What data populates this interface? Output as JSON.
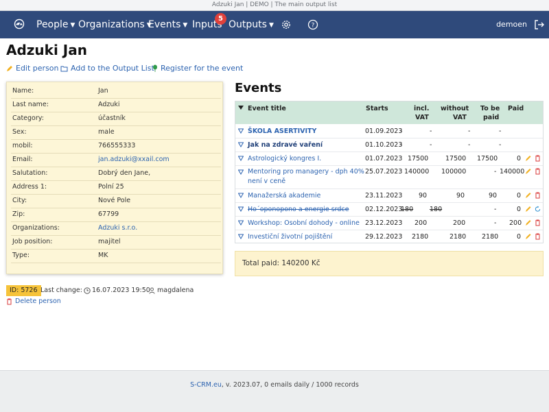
{
  "window": {
    "title": "Adzuki Jan | DEMO | The main output list"
  },
  "nav": {
    "people": "People",
    "organizations": "Organizations",
    "events": "Events",
    "inputs": "Inputs",
    "inputs_badge": "5",
    "outputs": "Outputs",
    "user": "demoen"
  },
  "page": {
    "title": "Adzuki Jan",
    "actions": {
      "edit": "Edit person",
      "add_to_output": "Add to the Output List",
      "register": "Register for the event"
    }
  },
  "person": {
    "fields": [
      {
        "label": "Name:",
        "value": "Jan"
      },
      {
        "label": "Last name:",
        "value": "Adzuki"
      },
      {
        "label": "Category:",
        "value": "účastník"
      },
      {
        "label": "Sex:",
        "value": "male"
      },
      {
        "label": "mobil:",
        "value": "766555333"
      },
      {
        "label": "Email:",
        "value": "jan.adzuki@xxail.com"
      },
      {
        "label": "Salutation:",
        "value": "Dobrý den Jane,"
      },
      {
        "label": "Address 1:",
        "value": "Polní 25"
      },
      {
        "label": "City:",
        "value": "Nové Pole"
      },
      {
        "label": "Zip:",
        "value": "67799"
      },
      {
        "label": "Organizations:",
        "value": "Adzuki s.r.o."
      },
      {
        "label": "Job position:",
        "value": "majitel"
      },
      {
        "label": "Type:",
        "value": "MK"
      }
    ]
  },
  "events": {
    "title": "Events",
    "headers": {
      "title": "Event title",
      "starts": "Starts",
      "incl1": "incl.",
      "incl2": "VAT",
      "without1": "without",
      "without2": "VAT",
      "tobe1": "To be",
      "tobe2": "paid",
      "paid": "Paid"
    },
    "rows": [
      {
        "title": "ŠKOLA ASERTIVITY",
        "starts": "01.09.2023",
        "incl": "-",
        "without": "-",
        "tobe": "-",
        "paid": "-"
      },
      {
        "title": "Jak na zdravé vaření",
        "starts": "01.10.2023",
        "incl": "-",
        "without": "-",
        "tobe": "-",
        "paid": "-"
      },
      {
        "title": "Astrologický kongres I.",
        "starts": "01.07.2023",
        "incl": "17500",
        "without": "17500",
        "tobe": "17500",
        "paid": "0"
      },
      {
        "title1": "Mentoring pro managery - dph 40%",
        "title2": "není v ceně",
        "starts": "25.07.2023",
        "incl": "140000",
        "without": "100000",
        "tobe": "-",
        "paid": "140000"
      },
      {
        "title": "Manažerská akademie",
        "starts": "23.11.2023",
        "incl": "90",
        "without": "90",
        "tobe": "90",
        "paid": "0"
      },
      {
        "title": "Ho´oponopono a energie srdce",
        "starts": "02.12.2023",
        "incl": "180",
        "without": "180",
        "tobe": "-",
        "paid": "0"
      },
      {
        "title": "Workshop: Osobní dohody - online",
        "starts": "23.12.2023",
        "incl": "200",
        "without": "200",
        "tobe": "-",
        "paid": "200"
      },
      {
        "title": "Investiční životní pojištění",
        "starts": "29.12.2023",
        "incl": "2180",
        "without": "2180",
        "tobe": "2180",
        "paid": "0"
      }
    ],
    "total_paid": "Total paid: 140200 Kč"
  },
  "meta": {
    "id": "ID: 5726",
    "last_change_label": "Last change:",
    "last_change": "16.07.2023 19:50",
    "user": "magdalena",
    "delete": "Delete person"
  },
  "footer": {
    "link": "S-CRM.eu",
    "text": ", v. 2023.07, 0 emails daily / 1000 records"
  },
  "colors": {
    "navbar": "#2f4a7b",
    "badge": "#e0413b",
    "link": "#2c63b0",
    "card_bg": "#fdf6d7",
    "table_header": "#cfe7da",
    "id_badge": "#f6c33a"
  }
}
